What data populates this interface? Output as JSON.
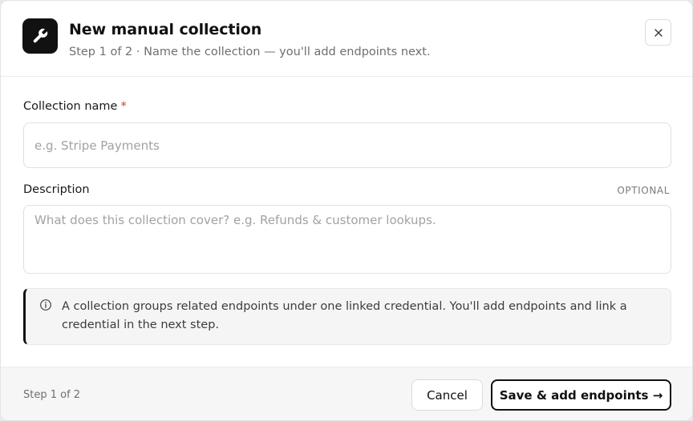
{
  "header": {
    "app_icon": "wrench-icon",
    "title": "New manual collection",
    "subtitle": "Step 1 of 2 · Name the collection — you'll add endpoints next.",
    "close_icon": "close-icon"
  },
  "form": {
    "name": {
      "label": "Collection name",
      "required_mark": "*",
      "placeholder": "e.g. Stripe Payments",
      "value": ""
    },
    "description": {
      "label": "Description",
      "optional_tag": "OPTIONAL",
      "placeholder": "What does this collection cover? e.g. Refunds & customer lookups.",
      "value": ""
    }
  },
  "info": {
    "icon": "info-icon",
    "text": "A collection groups related endpoints under one linked credential. You'll add endpoints and link a credential in the next step."
  },
  "footer": {
    "step_text": "Step 1 of 2",
    "cancel_label": "Cancel",
    "primary_label": "Save & add endpoints →"
  },
  "colors": {
    "accent": "#111111",
    "required": "#c93a2a",
    "muted_text": "#6f6f6f",
    "footer_bg": "#f6f6f6"
  }
}
